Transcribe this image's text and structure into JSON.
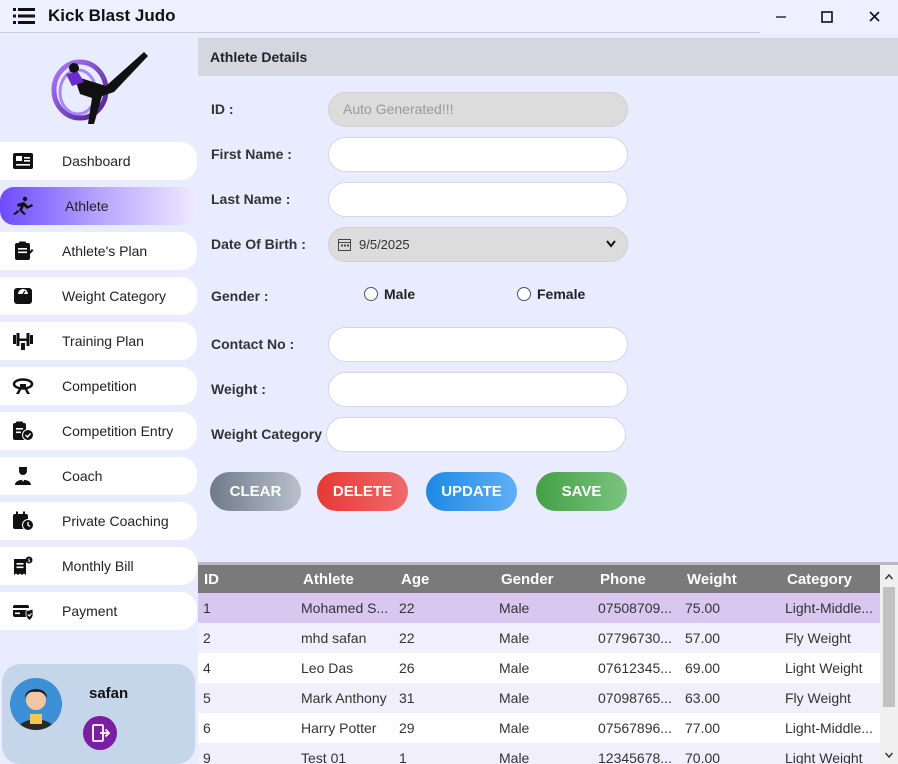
{
  "app": {
    "title": "Kick Blast Judo"
  },
  "sidebar": {
    "items": [
      {
        "label": "Dashboard",
        "icon": "dashboard-icon"
      },
      {
        "label": "Athlete",
        "icon": "athlete-icon"
      },
      {
        "label": "Athlete's Plan",
        "icon": "clipboard-icon"
      },
      {
        "label": "Weight Category",
        "icon": "scale-icon"
      },
      {
        "label": "Training Plan",
        "icon": "dumbbell-icon"
      },
      {
        "label": "Competition",
        "icon": "belt-icon"
      },
      {
        "label": "Competition Entry",
        "icon": "clipboard-check-icon"
      },
      {
        "label": "Coach",
        "icon": "coach-icon"
      },
      {
        "label": "Private Coaching",
        "icon": "calendar-clock-icon"
      },
      {
        "label": "Monthly Bill",
        "icon": "bill-icon"
      },
      {
        "label": "Payment",
        "icon": "payment-icon"
      }
    ],
    "active": "Athlete",
    "profile": {
      "username": "safan"
    }
  },
  "form": {
    "heading": "Athlete Details",
    "labels": {
      "id": "ID :",
      "first_name": "First Name :",
      "last_name": "Last Name :",
      "dob": "Date Of Birth :",
      "gender": "Gender :",
      "contact": "Contact No :",
      "weight": "Weight :",
      "weight_category": "Weight Category :"
    },
    "values": {
      "id": "Auto Generated!!!",
      "first_name": "",
      "last_name": "",
      "dob": "9/5/2025",
      "contact": "",
      "weight": "",
      "weight_category": ""
    },
    "gender_options": [
      "Male",
      "Female"
    ],
    "buttons": {
      "clear": "CLEAR",
      "delete": "DELETE",
      "update": "UPDATE",
      "save": "SAVE"
    }
  },
  "table": {
    "columns": [
      "ID",
      "Athlete",
      "Age",
      "Gender",
      "Phone",
      "Weight",
      "Category"
    ],
    "rows": [
      [
        "1",
        "Mohamed S...",
        "22",
        "Male",
        "07508709...",
        "75.00",
        "Light-Middle..."
      ],
      [
        "2",
        "mhd safan",
        "22",
        "Male",
        "07796730...",
        "57.00",
        "Fly Weight"
      ],
      [
        "4",
        "Leo Das",
        "26",
        "Male",
        "07612345...",
        "69.00",
        "Light Weight"
      ],
      [
        "5",
        "Mark Anthony",
        "31",
        "Male",
        "07098765...",
        "63.00",
        "Fly Weight"
      ],
      [
        "6",
        "Harry Potter",
        "29",
        "Male",
        "07567896...",
        "77.00",
        "Light-Middle..."
      ],
      [
        "9",
        "Test 01",
        "1",
        "Male",
        "12345678...",
        "70.00",
        "Light Weight"
      ]
    ],
    "selected_row": 0
  },
  "colors": {
    "accent": "#6d4bff",
    "header_bg": "#7a7a7a",
    "selected_row": "#d8c8f0",
    "alt_row": "#f2effc"
  }
}
